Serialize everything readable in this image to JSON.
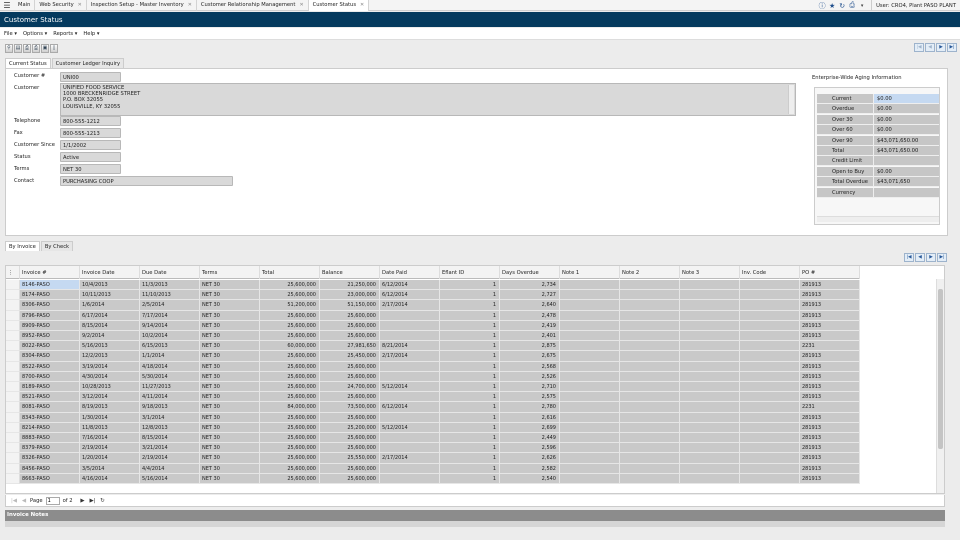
{
  "topbar": {
    "tabs": [
      "Main",
      "Web Security",
      "Inspection Setup - Master Inventory",
      "Customer Relationship Management",
      "Customer Status"
    ],
    "user": "User: CRO4, Plant PASO PLANT"
  },
  "window_title": "Customer Status",
  "menus": [
    "File ▾",
    "Options ▾",
    "Reports ▾",
    "Help ▾"
  ],
  "main_tabs": [
    "Current Status",
    "Customer Ledger Inquiry"
  ],
  "fields": {
    "customer_no_label": "Customer #",
    "customer_no": "UNI00",
    "customer_label": "Customer",
    "address": [
      "UNIFIED FOOD SERVICE",
      "1000 BRECKENRIDGE STREET",
      "P.O. BOX 32055",
      "LOUISVILLE, KY 32055"
    ],
    "telephone_label": "Telephone",
    "telephone": "800-555-1212",
    "fax_label": "Fax",
    "fax": "800-555-1213",
    "since_label": "Customer Since",
    "since": "1/1/2002",
    "status_label": "Status",
    "status": "Active",
    "terms_label": "Terms",
    "terms": "NET 30",
    "contact_label": "Contact",
    "contact": "PURCHASING COOP"
  },
  "aging": {
    "title": "Enterprise-Wide Aging Information",
    "rows": [
      {
        "k": "Current",
        "v": "$0.00"
      },
      {
        "k": "Overdue",
        "v": "$0.00"
      },
      {
        "k": "Over 30",
        "v": "$0.00"
      },
      {
        "k": "Over 60",
        "v": "$0.00"
      },
      {
        "k": "Over 90",
        "v": "$43,071,650.00"
      },
      {
        "k": "Total",
        "v": "$43,071,650.00"
      },
      {
        "k": "Credit Limit",
        "v": ""
      },
      {
        "k": "Open to Buy",
        "v": "$0.00"
      },
      {
        "k": "Total Overdue",
        "v": "$43,071,650"
      },
      {
        "k": "Currency",
        "v": ""
      }
    ]
  },
  "sub_tabs": [
    "By Invoice",
    "By Check"
  ],
  "grid": {
    "columns": [
      "Invoice #",
      "Invoice Date",
      "Due Date",
      "Terms",
      "Total",
      "Balance",
      "Date Paid",
      "Eflant ID",
      "Days Overdue",
      "Note 1",
      "Note 2",
      "Note 3",
      "Inv. Code",
      "PO #"
    ],
    "rows": [
      [
        "8146-PASO",
        "10/4/2013",
        "11/3/2013",
        "NET 30",
        "25,600,000",
        "21,250,000",
        "6/12/2014",
        "1",
        "2,734",
        "",
        "",
        "",
        "",
        "281913"
      ],
      [
        "8174-PASO",
        "10/11/2013",
        "11/10/2013",
        "NET 30",
        "25,600,000",
        "23,000,000",
        "6/12/2014",
        "1",
        "2,727",
        "",
        "",
        "",
        "",
        "281913"
      ],
      [
        "8306-PASO",
        "1/6/2014",
        "2/5/2014",
        "NET 30",
        "51,200,000",
        "51,150,000",
        "2/17/2014",
        "1",
        "2,640",
        "",
        "",
        "",
        "",
        "281913"
      ],
      [
        "8796-PASO",
        "6/17/2014",
        "7/17/2014",
        "NET 30",
        "25,600,000",
        "25,600,000",
        "",
        "1",
        "2,478",
        "",
        "",
        "",
        "",
        "281913"
      ],
      [
        "8909-PASO",
        "8/15/2014",
        "9/14/2014",
        "NET 30",
        "25,600,000",
        "25,600,000",
        "",
        "1",
        "2,419",
        "",
        "",
        "",
        "",
        "281913"
      ],
      [
        "8952-PASO",
        "9/2/2014",
        "10/2/2014",
        "NET 30",
        "25,600,000",
        "25,600,000",
        "",
        "1",
        "2,401",
        "",
        "",
        "",
        "",
        "281913"
      ],
      [
        "8022-PASO",
        "5/16/2013",
        "6/15/2013",
        "NET 30",
        "60,000,000",
        "27,981,650",
        "8/21/2014",
        "1",
        "2,875",
        "",
        "",
        "",
        "",
        "2231"
      ],
      [
        "8304-PASO",
        "12/2/2013",
        "1/1/2014",
        "NET 30",
        "25,600,000",
        "25,450,000",
        "2/17/2014",
        "1",
        "2,675",
        "",
        "",
        "",
        "",
        "281913"
      ],
      [
        "8522-PASO",
        "3/19/2014",
        "4/18/2014",
        "NET 30",
        "25,600,000",
        "25,600,000",
        "",
        "1",
        "2,568",
        "",
        "",
        "",
        "",
        "281913"
      ],
      [
        "8700-PASO",
        "4/30/2014",
        "5/30/2014",
        "NET 30",
        "25,600,000",
        "25,600,000",
        "",
        "1",
        "2,526",
        "",
        "",
        "",
        "",
        "281913"
      ],
      [
        "8189-PASO",
        "10/28/2013",
        "11/27/2013",
        "NET 30",
        "25,600,000",
        "24,700,000",
        "5/12/2014",
        "1",
        "2,710",
        "",
        "",
        "",
        "",
        "281913"
      ],
      [
        "8521-PASO",
        "3/12/2014",
        "4/11/2014",
        "NET 30",
        "25,600,000",
        "25,600,000",
        "",
        "1",
        "2,575",
        "",
        "",
        "",
        "",
        "281913"
      ],
      [
        "8081-PASO",
        "8/19/2013",
        "9/18/2013",
        "NET 30",
        "84,000,000",
        "73,500,000",
        "6/12/2014",
        "1",
        "2,780",
        "",
        "",
        "",
        "",
        "2231"
      ],
      [
        "8343-PASO",
        "1/30/2014",
        "3/1/2014",
        "NET 30",
        "25,600,000",
        "25,600,000",
        "",
        "1",
        "2,616",
        "",
        "",
        "",
        "",
        "281913"
      ],
      [
        "8214-PASO",
        "11/8/2013",
        "12/8/2013",
        "NET 30",
        "25,600,000",
        "25,200,000",
        "5/12/2014",
        "1",
        "2,699",
        "",
        "",
        "",
        "",
        "281913"
      ],
      [
        "8883-PASO",
        "7/16/2014",
        "8/15/2014",
        "NET 30",
        "25,600,000",
        "25,600,000",
        "",
        "1",
        "2,449",
        "",
        "",
        "",
        "",
        "281913"
      ],
      [
        "8379-PASO",
        "2/19/2014",
        "3/21/2014",
        "NET 30",
        "25,600,000",
        "25,600,000",
        "",
        "1",
        "2,596",
        "",
        "",
        "",
        "",
        "281913"
      ],
      [
        "8326-PASO",
        "1/20/2014",
        "2/19/2014",
        "NET 30",
        "25,600,000",
        "25,550,000",
        "2/17/2014",
        "1",
        "2,626",
        "",
        "",
        "",
        "",
        "281913"
      ],
      [
        "8456-PASO",
        "3/5/2014",
        "4/4/2014",
        "NET 30",
        "25,600,000",
        "25,600,000",
        "",
        "1",
        "2,582",
        "",
        "",
        "",
        "",
        "281913"
      ],
      [
        "8663-PASO",
        "4/16/2014",
        "5/16/2014",
        "NET 30",
        "25,600,000",
        "25,600,000",
        "",
        "1",
        "2,540",
        "",
        "",
        "",
        "",
        "281913"
      ]
    ]
  },
  "pager": {
    "page_label": "Page",
    "page": "1",
    "of": "of 2"
  },
  "notes_title": "Invoice Notes",
  "colors": {
    "title_bar": "#053a5e",
    "selected": "#c5d9f1",
    "cell": "#c9c9c9"
  }
}
